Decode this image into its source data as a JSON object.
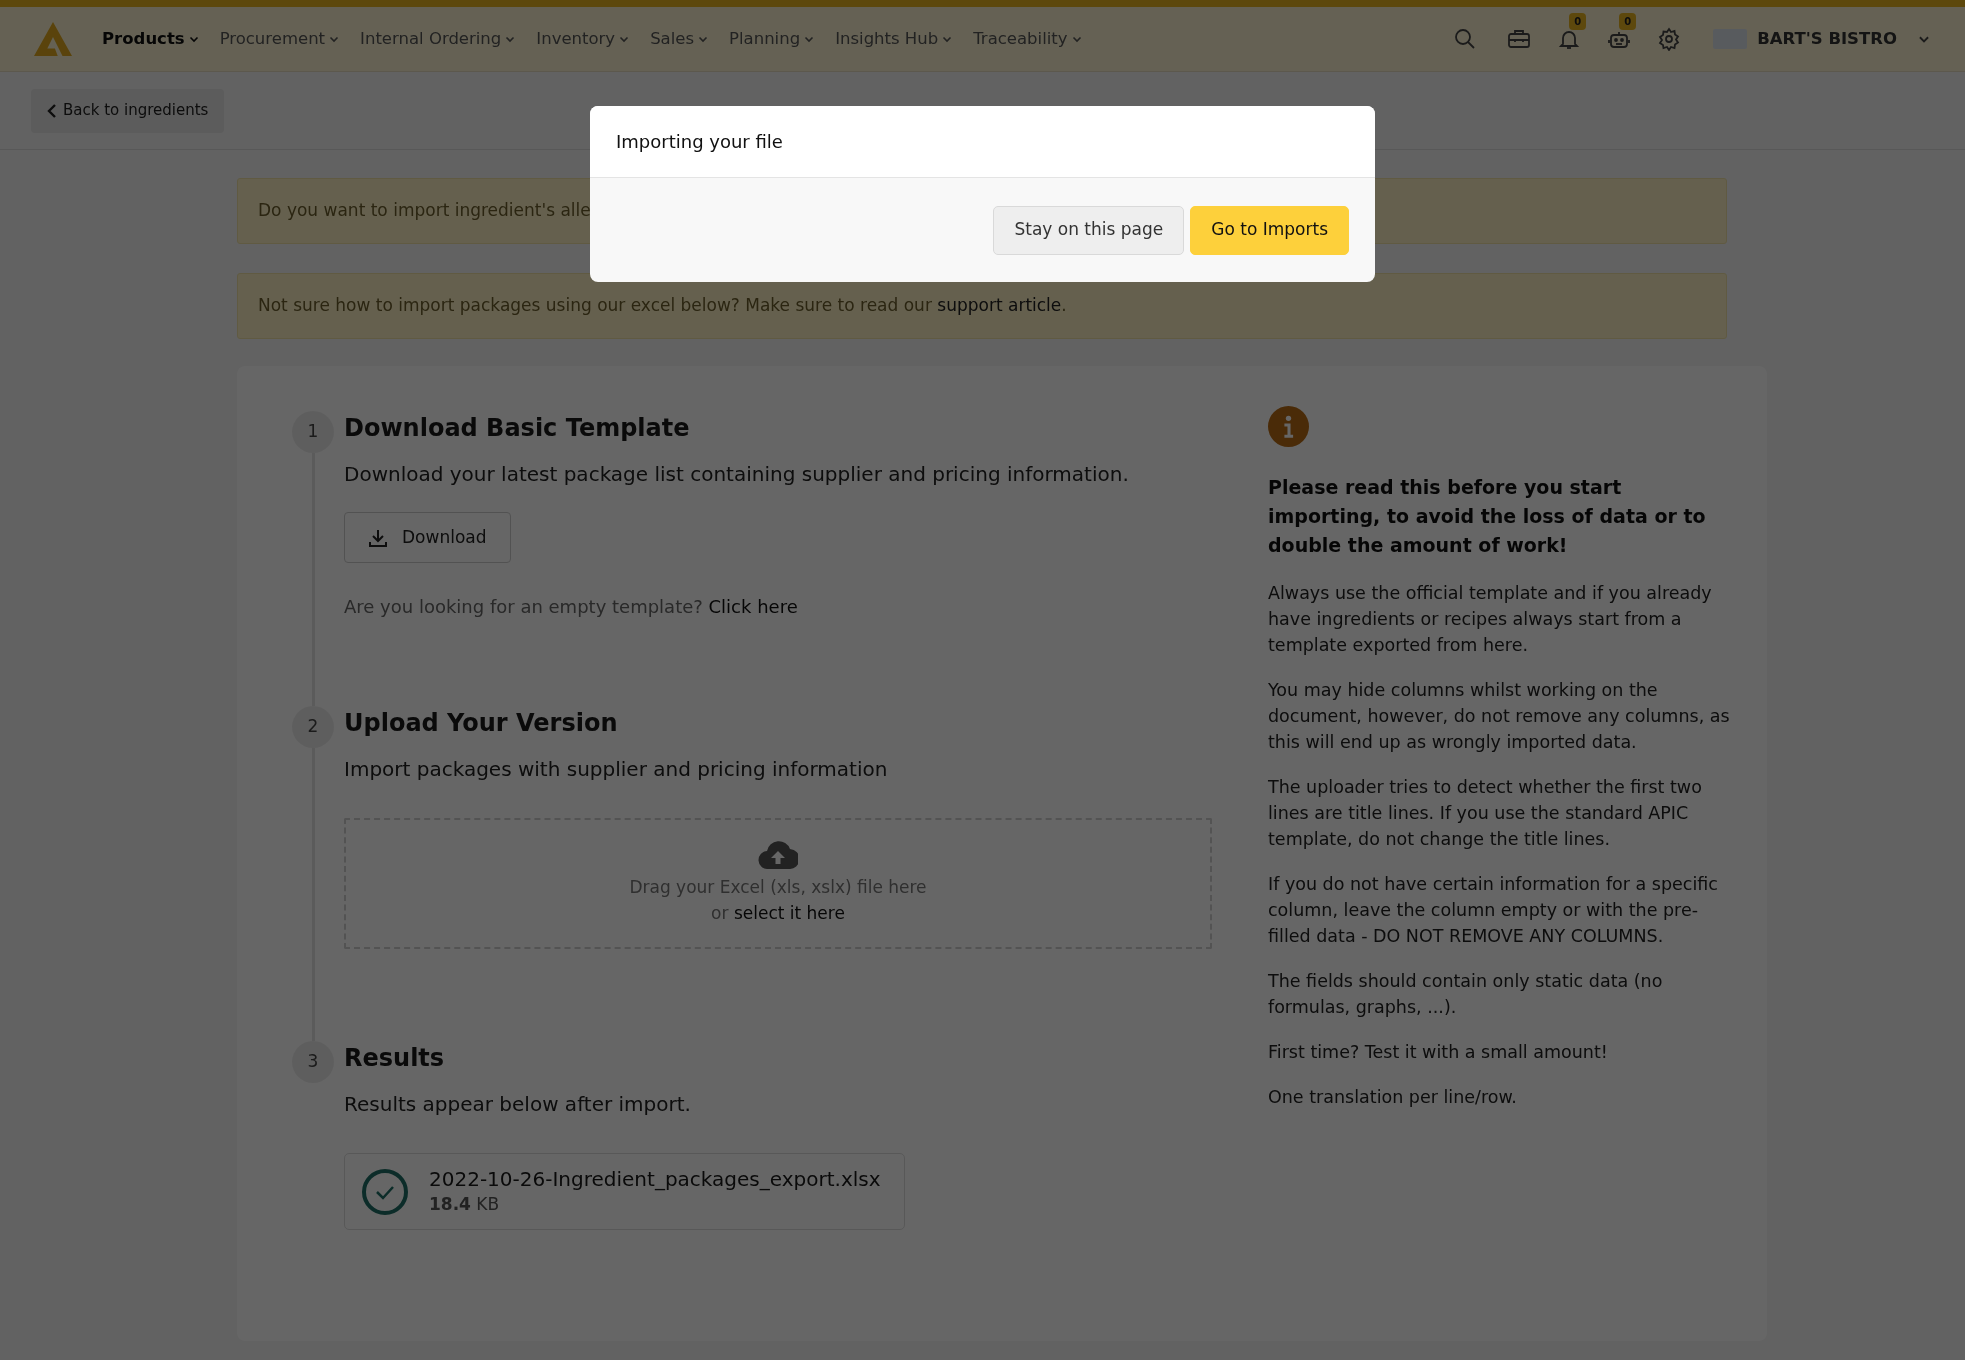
{
  "nav": {
    "items": [
      {
        "label": "Products",
        "selected": true
      },
      {
        "label": "Procurement",
        "selected": false
      },
      {
        "label": "Internal Ordering",
        "selected": false
      },
      {
        "label": "Inventory",
        "selected": false
      },
      {
        "label": "Sales",
        "selected": false
      },
      {
        "label": "Planning",
        "selected": false
      },
      {
        "label": "Insights Hub",
        "selected": false
      },
      {
        "label": "Traceability",
        "selected": false
      }
    ],
    "notifications_count": "0",
    "assistant_count": "0",
    "account": "BART'S BISTRO"
  },
  "back_button": "Back to ingredients",
  "banners": [
    {
      "text": "Do you want to import ingredient's alle"
    },
    {
      "text": "Not sure how to import packages using our excel below? Make sure to read our ",
      "link": "support article",
      "suffix": "."
    }
  ],
  "steps": [
    {
      "kind": "download",
      "number": "1",
      "title": "Download Basic Template",
      "description": "Download your latest package list containing supplier and pricing information.",
      "button": "Download",
      "hint": "Are you looking for an empty template? ",
      "hint_link": "Click here"
    },
    {
      "kind": "upload",
      "number": "2",
      "title": "Upload Your Version",
      "description": "Import packages with supplier and pricing information",
      "drop_text": "Drag your Excel (xls, xslx) file here",
      "drop_prefix": "or ",
      "drop_link": "select it here"
    },
    {
      "kind": "results",
      "number": "3",
      "title": "Results",
      "description": "Results appear below after import.",
      "file_name": "2022-10-26-Ingredient_packages_export.xlsx",
      "file_size": "**18.4** KB"
    }
  ],
  "info": {
    "heading": "Please read this before you start importing, to avoid the loss of data or to double the amount of work!",
    "paragraphs": [
      "Always use the official template and if you already have ingredients or recipes always start from a template exported from here.",
      "You may hide columns whilst working on the document, however, do not remove any columns, as this will end up as wrongly imported data.",
      "The uploader tries to detect whether the first two lines are title lines. If you use the standard APIC template, do not change the title lines.",
      "If you do not have certain information for a specific column, leave the column empty or with the pre-filled data - DO NOT REMOVE ANY COLUMNS.",
      "The fields should contain only static data (no formulas, graphs, ...).",
      "First time? Test it with a small amount!",
      "One translation per line/row."
    ]
  },
  "modal": {
    "title": "Importing your file",
    "buttons": [
      {
        "label": "Stay on this page",
        "kind": "secondary"
      },
      {
        "label": "Go to Imports",
        "kind": "primary"
      }
    ]
  }
}
